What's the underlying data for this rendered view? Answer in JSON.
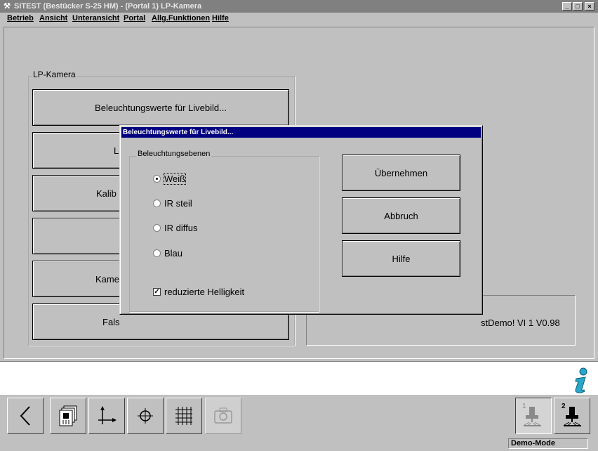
{
  "window": {
    "title": "SITEST (Bestücker S-25 HM) - (Portal 1) LP-Kamera",
    "minimize": "_",
    "maximize": "□",
    "close": "×"
  },
  "menu": [
    "Betrieb",
    "Ansicht",
    "Unteransicht",
    "Portal",
    "Allg.Funktionen",
    "Hilfe"
  ],
  "main": {
    "group_label": "LP-Kamera",
    "buttons": [
      "Beleuchtungswerte für Livebild...",
      "L",
      "Kalib",
      "",
      "Kame",
      "Fals"
    ],
    "info_text": "stDemo! VI 1 V0.98"
  },
  "dialog": {
    "title": "Beleuchtungswerte für Livebild...",
    "group_label": "Beleuchtungsebenen",
    "options": [
      "Weiß",
      "IR steil",
      "IR diffus",
      "Blau"
    ],
    "selected_option": "Weiß",
    "checkbox_label": "reduzierte Helligkeit",
    "checkbox_checked": true,
    "buttons": {
      "apply": "Übernehmen",
      "cancel": "Abbruch",
      "help": "Hilfe"
    }
  },
  "toolbar": {
    "icons": [
      "back-arrow-icon",
      "component-stack-icon",
      "xy-axes-icon",
      "crosshair-icon",
      "grid-icon",
      "camera-icon-disabled"
    ],
    "portal_labels": [
      "1",
      "2"
    ]
  },
  "status": {
    "mode": "Demo-Mode"
  },
  "colors": {
    "titlebar_inactive": "#808080",
    "dialog_title": "#000080",
    "info_icon": "#2aa7c8"
  }
}
